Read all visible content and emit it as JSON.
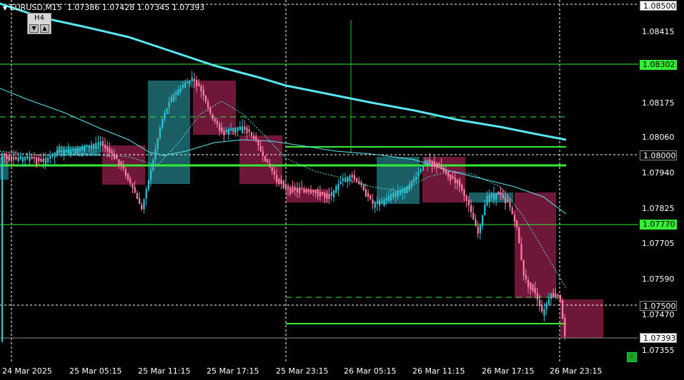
{
  "title": {
    "symbol_line": "EURUSD,M15",
    "ohlc": "1.07386 1.07428 1.07345 1.07393"
  },
  "timeframe_panel": {
    "label": "H4",
    "down": "▼",
    "up": "▲"
  },
  "price_axis": [
    "1.08500",
    "1.08415",
    "1.08302",
    "1.08175",
    "1.08060",
    "1.08000",
    "1.07940",
    "1.07825",
    "1.07770",
    "1.07705",
    "1.07590",
    "1.07500",
    "1.07470",
    "1.07393",
    "1.07355"
  ],
  "highlighted_prices": {
    "level_green_top": "1.08302",
    "level_green_bottom": "1.07770",
    "top_edge": "1.08500",
    "round_level": "1.08000",
    "round_level_2": "1.07500",
    "current": "1.07393"
  },
  "time_axis": [
    "24 Mar 2025",
    "25 Mar 05:15",
    "25 Mar 11:15",
    "25 Mar 17:15",
    "25 Mar 23:15",
    "26 Mar 05:15",
    "26 Mar 11:15",
    "26 Mar 17:15",
    "26 Mar 23:15"
  ],
  "minus_button": "-",
  "colors": {
    "bull": "#2ec4d6",
    "bear": "#ff7fa8",
    "bull_box": "#1f6f75",
    "bear_box": "#7a1a3e",
    "level": "#33ee33",
    "ma_slow": "#58e6f0",
    "grid": "#ffffff"
  },
  "chart_data": {
    "type": "candlestick",
    "symbol": "EURUSD",
    "timeframe": "M15",
    "ylim": [
      1.0732,
      1.0853
    ],
    "horizontal_levels": [
      1.08302,
      1.0813,
      1.0802,
      1.07965,
      1.0777,
      1.07535,
      1.0744
    ],
    "last_price": 1.07393
  }
}
